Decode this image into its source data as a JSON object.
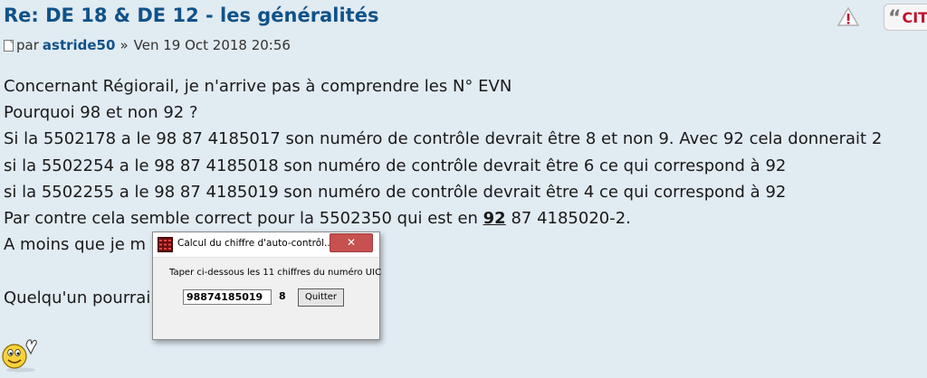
{
  "post": {
    "title": "Re: DE 18 & DE 12 - les généralités",
    "author_prefix": "par",
    "author": "astride50",
    "separator": "»",
    "date": "Ven 19 Oct 2018 20:56",
    "actions": {
      "report_icon": "report-icon",
      "quote_label": "CIT"
    },
    "lines": [
      "Concernant Régiorail, je n'arrive pas à comprendre les N° EVN",
      "Pourquoi 98 et non 92 ?",
      "Si la 5502178 a le 98 87 4185017 son numéro de contrôle devrait être 8 et non 9. Avec 92 cela donnerait 2",
      "si la 5502254 a le 98 87 4185018 son numéro de contrôle devrait être 6 ce qui correspond à 92",
      "si la 5502255 a le 98 87 4185019 son numéro de contrôle devrait être 4 ce qui correspond à 92"
    ],
    "line_contre": {
      "before": "Par contre cela semble correct pour la 5502350 qui est en ",
      "emph": "92",
      "after": " 87 4185020-2."
    },
    "line_moins": "A moins que je m",
    "line_quelqu": "Quelqu'un pourrai",
    "smiley_icon": "waving-smiley-icon"
  },
  "dialog": {
    "title": "Calcul du chiffre d'auto-contrôl...",
    "close_label": "✕",
    "prompt": "Taper ci-dessous les 11 chiffres du numéro UIC",
    "input_value": "98874185019",
    "result": "8",
    "quit_label": "Quitter"
  },
  "colors": {
    "background": "#e1ebf2",
    "title": "#105289",
    "accent": "#c0102c"
  }
}
